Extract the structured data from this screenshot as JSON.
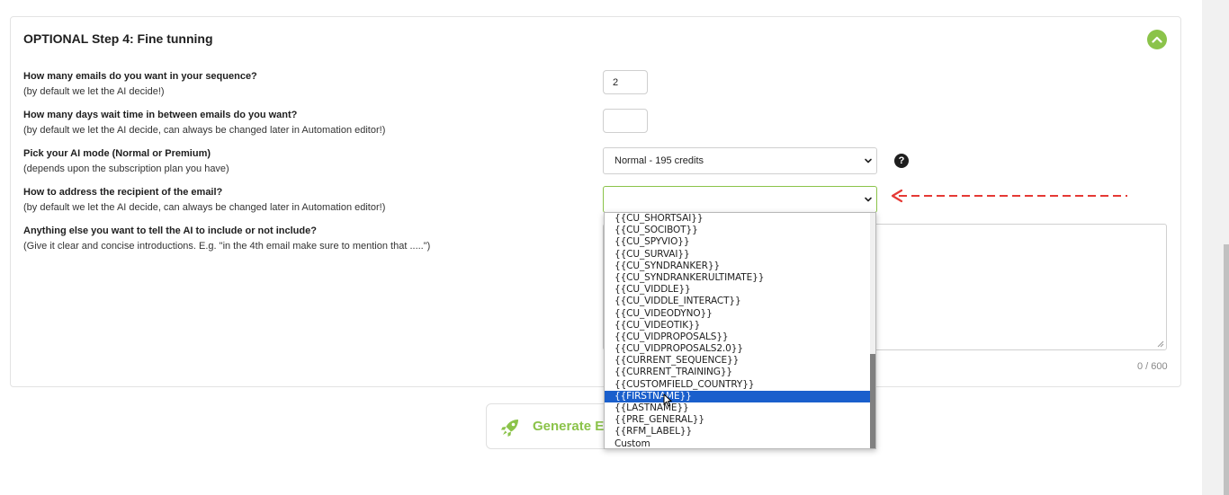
{
  "section": {
    "title": "OPTIONAL Step 4: Fine tunning"
  },
  "questions": [
    {
      "label": "How many emails do you want in your sequence?",
      "hint": "(by default we let the AI decide!)",
      "value": "2"
    },
    {
      "label": "How many days wait time in between emails do you want?",
      "hint": "(by default we let the AI decide, can always be changed later in Automation editor!)",
      "value": ""
    },
    {
      "label": "Pick your AI mode (Normal or Premium)",
      "hint": "(depends upon the subscription plan you have)",
      "value": "Normal - 195 credits"
    },
    {
      "label": "How to address the recipient of the email?",
      "hint": "(by default we let the AI decide, can always be changed later in Automation editor!)",
      "value": ""
    },
    {
      "label": "Anything else you want to tell the AI to include or not include?",
      "hint": "(Give it clear and concise introductions. E.g. \"in the 4th email make sure to mention that .....\")",
      "value": ""
    }
  ],
  "help": {
    "glyph": "?"
  },
  "char_count": "0 / 600",
  "generate": {
    "label": "Generate E"
  },
  "dropdown": {
    "options": [
      "{{CU_SHORTSAI}}",
      "{{CU_SOCIBOT}}",
      "{{CU_SPYVIO}}",
      "{{CU_SURVAI}}",
      "{{CU_SYNDRANKER}}",
      "{{CU_SYNDRANKERULTIMATE}}",
      "{{CU_VIDDLE}}",
      "{{CU_VIDDLE_INTERACT}}",
      "{{CU_VIDEODYNO}}",
      "{{CU_VIDEOTIK}}",
      "{{CU_VIDPROPOSALS}}",
      "{{CU_VIDPROPOSALS2.0}}",
      "{{CURRENT_SEQUENCE}}",
      "{{CURRENT_TRAINING}}",
      "{{CUSTOMFIELD_COUNTRY}}",
      "{{FIRSTNAME}}",
      "{{LASTNAME}}",
      "{{PRE_GENERAL}}",
      "{{RFM_LABEL}}",
      "Custom"
    ],
    "highlighted": "{{FIRSTNAME}}"
  },
  "colors": {
    "accent": "#8bc34a",
    "selection": "#1a5fcc",
    "arrow": "#e53935"
  }
}
